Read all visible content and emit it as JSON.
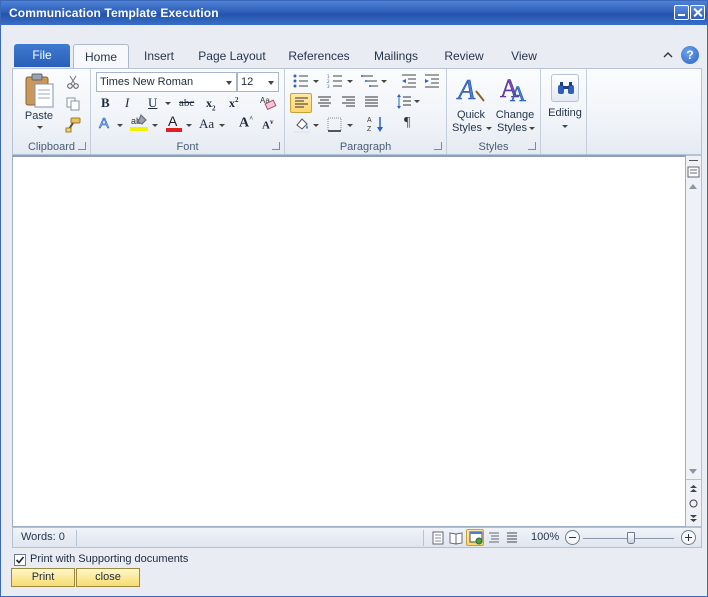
{
  "window": {
    "title": "Communication Template Execution"
  },
  "ribbon": {
    "file_tab": "File",
    "tabs": [
      "Home",
      "Insert",
      "Page Layout",
      "References",
      "Mailings",
      "Review",
      "View"
    ],
    "active_tab": "Home",
    "clipboard": {
      "label": "Clipboard",
      "paste": "Paste"
    },
    "font": {
      "label": "Font",
      "family": "Times New Roman",
      "size": "12"
    },
    "paragraph": {
      "label": "Paragraph"
    },
    "styles": {
      "label": "Styles",
      "quick_top": "Quick",
      "quick_bottom": "Styles",
      "change_top": "Change",
      "change_bottom": "Styles"
    },
    "editing": {
      "label": "Editing"
    }
  },
  "status": {
    "words": "Words: 0",
    "zoom": "100%"
  },
  "footer": {
    "print_supporting_label": "Print with Supporting documents",
    "print_supporting_checked": true,
    "print_button": "Print",
    "close_button": "close"
  },
  "colors": {
    "accent": "#2a5fb7",
    "highlight": "#ffd66b",
    "font_color": "#e02020",
    "highlight_color": "#f3f000"
  }
}
